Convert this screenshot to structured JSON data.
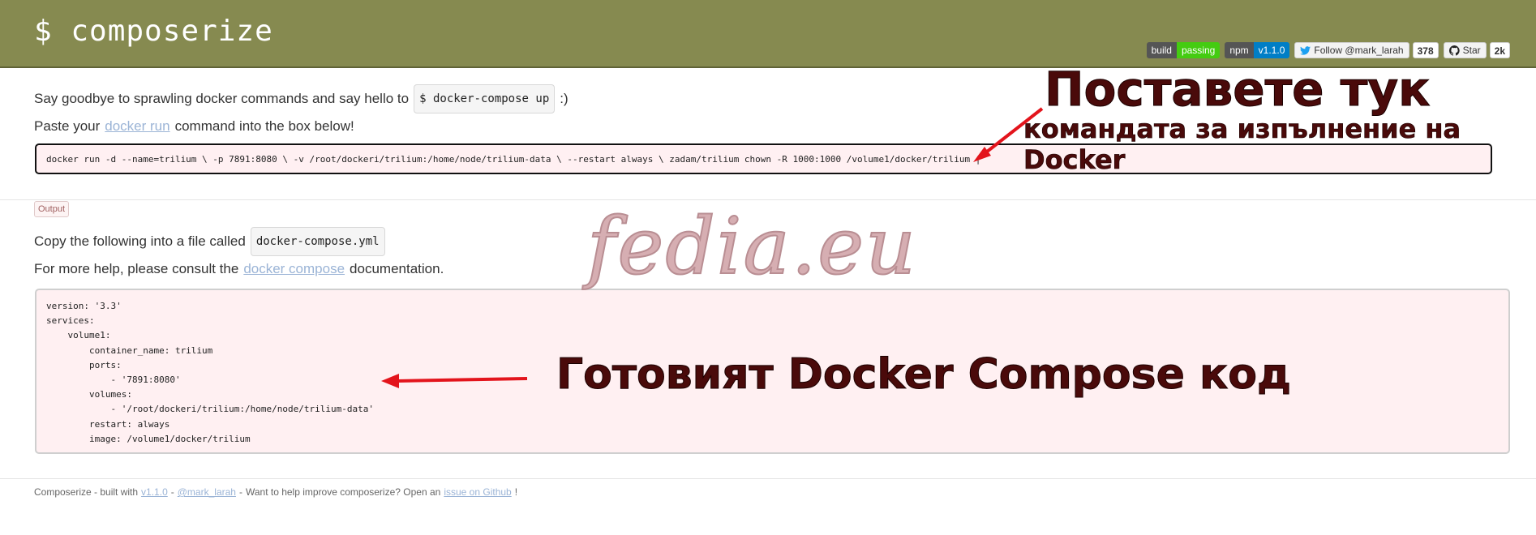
{
  "header": {
    "title": "$ composerize",
    "badges": {
      "build_label": "build",
      "build_status": "passing",
      "npm_label": "npm",
      "npm_version": "v1.1.0",
      "twitter_label": "Follow @mark_larah",
      "twitter_count": "378",
      "github_label": "Star",
      "github_count": "2k"
    }
  },
  "intro": {
    "line1_before": "Say goodbye to sprawling docker commands and say hello to",
    "line1_code": "$ docker-compose up",
    "line1_after": ":)",
    "line2_before": "Paste your",
    "line2_link": "docker run",
    "line2_after": "command into the box below!"
  },
  "input": {
    "value": "docker run -d --name=trilium \\ -p 7891:8080 \\ -v /root/dockeri/trilium:/home/node/trilium-data \\ --restart always \\ zadam/trilium chown -R 1000:1000 /volume1/docker/trilium |"
  },
  "output": {
    "tab_label": "Output",
    "line1_before": "Copy the following into a file called",
    "line1_code": "docker-compose.yml",
    "line2_before": "For more help, please consult the",
    "line2_link": "docker compose",
    "line2_after": "documentation.",
    "code": "version: '3.3'\nservices:\n    volume1:\n        container_name: trilium\n        ports:\n            - '7891:8080'\n        volumes:\n            - '/root/dockeri/trilium:/home/node/trilium-data'\n        restart: always\n        image: /volume1/docker/trilium"
  },
  "footer": {
    "text1": "Composerize - built with",
    "link_version": "v1.1.0",
    "sep1": "-",
    "link_author": "@mark_larah",
    "sep2": "-",
    "text2": "Want to help improve composerize? Open an",
    "link_issue": "issue on Github",
    "text3": "!"
  },
  "overlay": {
    "watermark": "fedia.eu",
    "annotation_title": "Поставете тук",
    "annotation_subtitle": "командата за изпълнение на Docker",
    "annotation_output": "Готовият Docker Compose код",
    "arrow_color": "#e3141c"
  },
  "colors": {
    "header_bg": "#868a50",
    "input_bg": "#fff0f2",
    "link": "#9bb4d6"
  }
}
